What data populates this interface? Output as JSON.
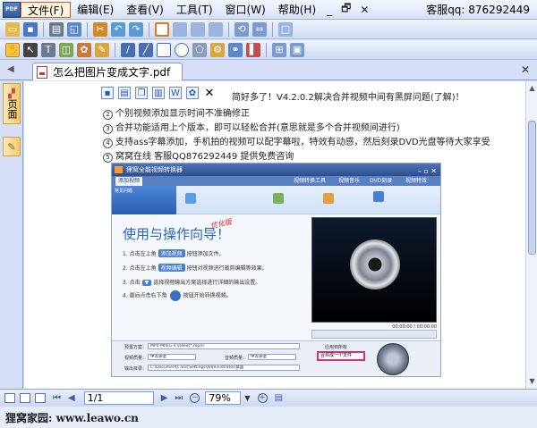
{
  "menu": {
    "items": [
      "文件(F)",
      "编辑(E)",
      "查看(V)",
      "工具(T)",
      "窗口(W)",
      "帮助(H)"
    ],
    "active_index": 0,
    "window_controls": [
      "_",
      "🗗",
      "✕"
    ],
    "support_text": "客服qq: 876292449"
  },
  "tab": {
    "title": "怎么把图片变成文字.pdf"
  },
  "side_panel": {
    "pages_label": "页面"
  },
  "document": {
    "lines": [
      "简好多了！V4.2.0.2解决合并视频中间有黑屏问题(了解)！",
      "个别视频添加显示时间不准确修正",
      "合并功能适用上个版本，即可以轻松合并(意思就是多个合并视频间进行)",
      "支持ass字幕添加，手机拍的视频可以配字幕啦，特效有动感，然后刻录DVD光盘等待大家享受",
      "窝窝在线 客服QQ876292449 提供免费咨询"
    ],
    "line_numbers": [
      "",
      "2",
      "3",
      "4",
      "5"
    ],
    "embedded": {
      "window_title": "狸窝全能视频转换器",
      "tabs": [
        "添加视频",
        "常见问题",
        "视频转换工具",
        "视频音乐",
        "DVD刻录",
        "视频特效"
      ],
      "wizard_title": "使用与操作向导！",
      "wizard_tag": "优化版",
      "steps": [
        {
          "pre": "1. 点击左上角",
          "pill": "添加视频",
          "post": "按钮添加文件。"
        },
        {
          "pre": "2. 点击左上角",
          "pill": "视频编辑",
          "post": "按钮对视频进行裁剪编辑等效果。"
        },
        {
          "pre": "3. 点击",
          "pill": "▼",
          "post": "选择视频输出方案选择进行详细的输出设置。"
        },
        {
          "pre": "4. 最后点击右下角",
          "pill": "",
          "post": "按钮开始转换视频。"
        }
      ],
      "time_readout": "00:00:00 / 00:00:00",
      "preset_label": "预置方案：",
      "preset_value": "MP4-MPEG-4 Video(*.mp4)",
      "video_quality_label": "视频质量：",
      "video_quality_value": "中等质量",
      "audio_quality_label": "音频质量：",
      "audio_quality_value": "中等质量",
      "output_label": "输出目录：",
      "output_value": "C:\\Documents and Settings\\Administrator\\桌面",
      "merge_label": "合并成一个文件",
      "apply_all_label": "应用到所有"
    }
  },
  "nav": {
    "page_value": "1/1",
    "zoom_value": "79%"
  },
  "footer": {
    "text": "狸窝家园: www.leawo.cn"
  },
  "colors": {
    "chrome": "#d6dff7",
    "active_menu_border": "#e05a1a",
    "merge_highlight": "#d6307d",
    "wizard_blue": "#2a66b8"
  }
}
